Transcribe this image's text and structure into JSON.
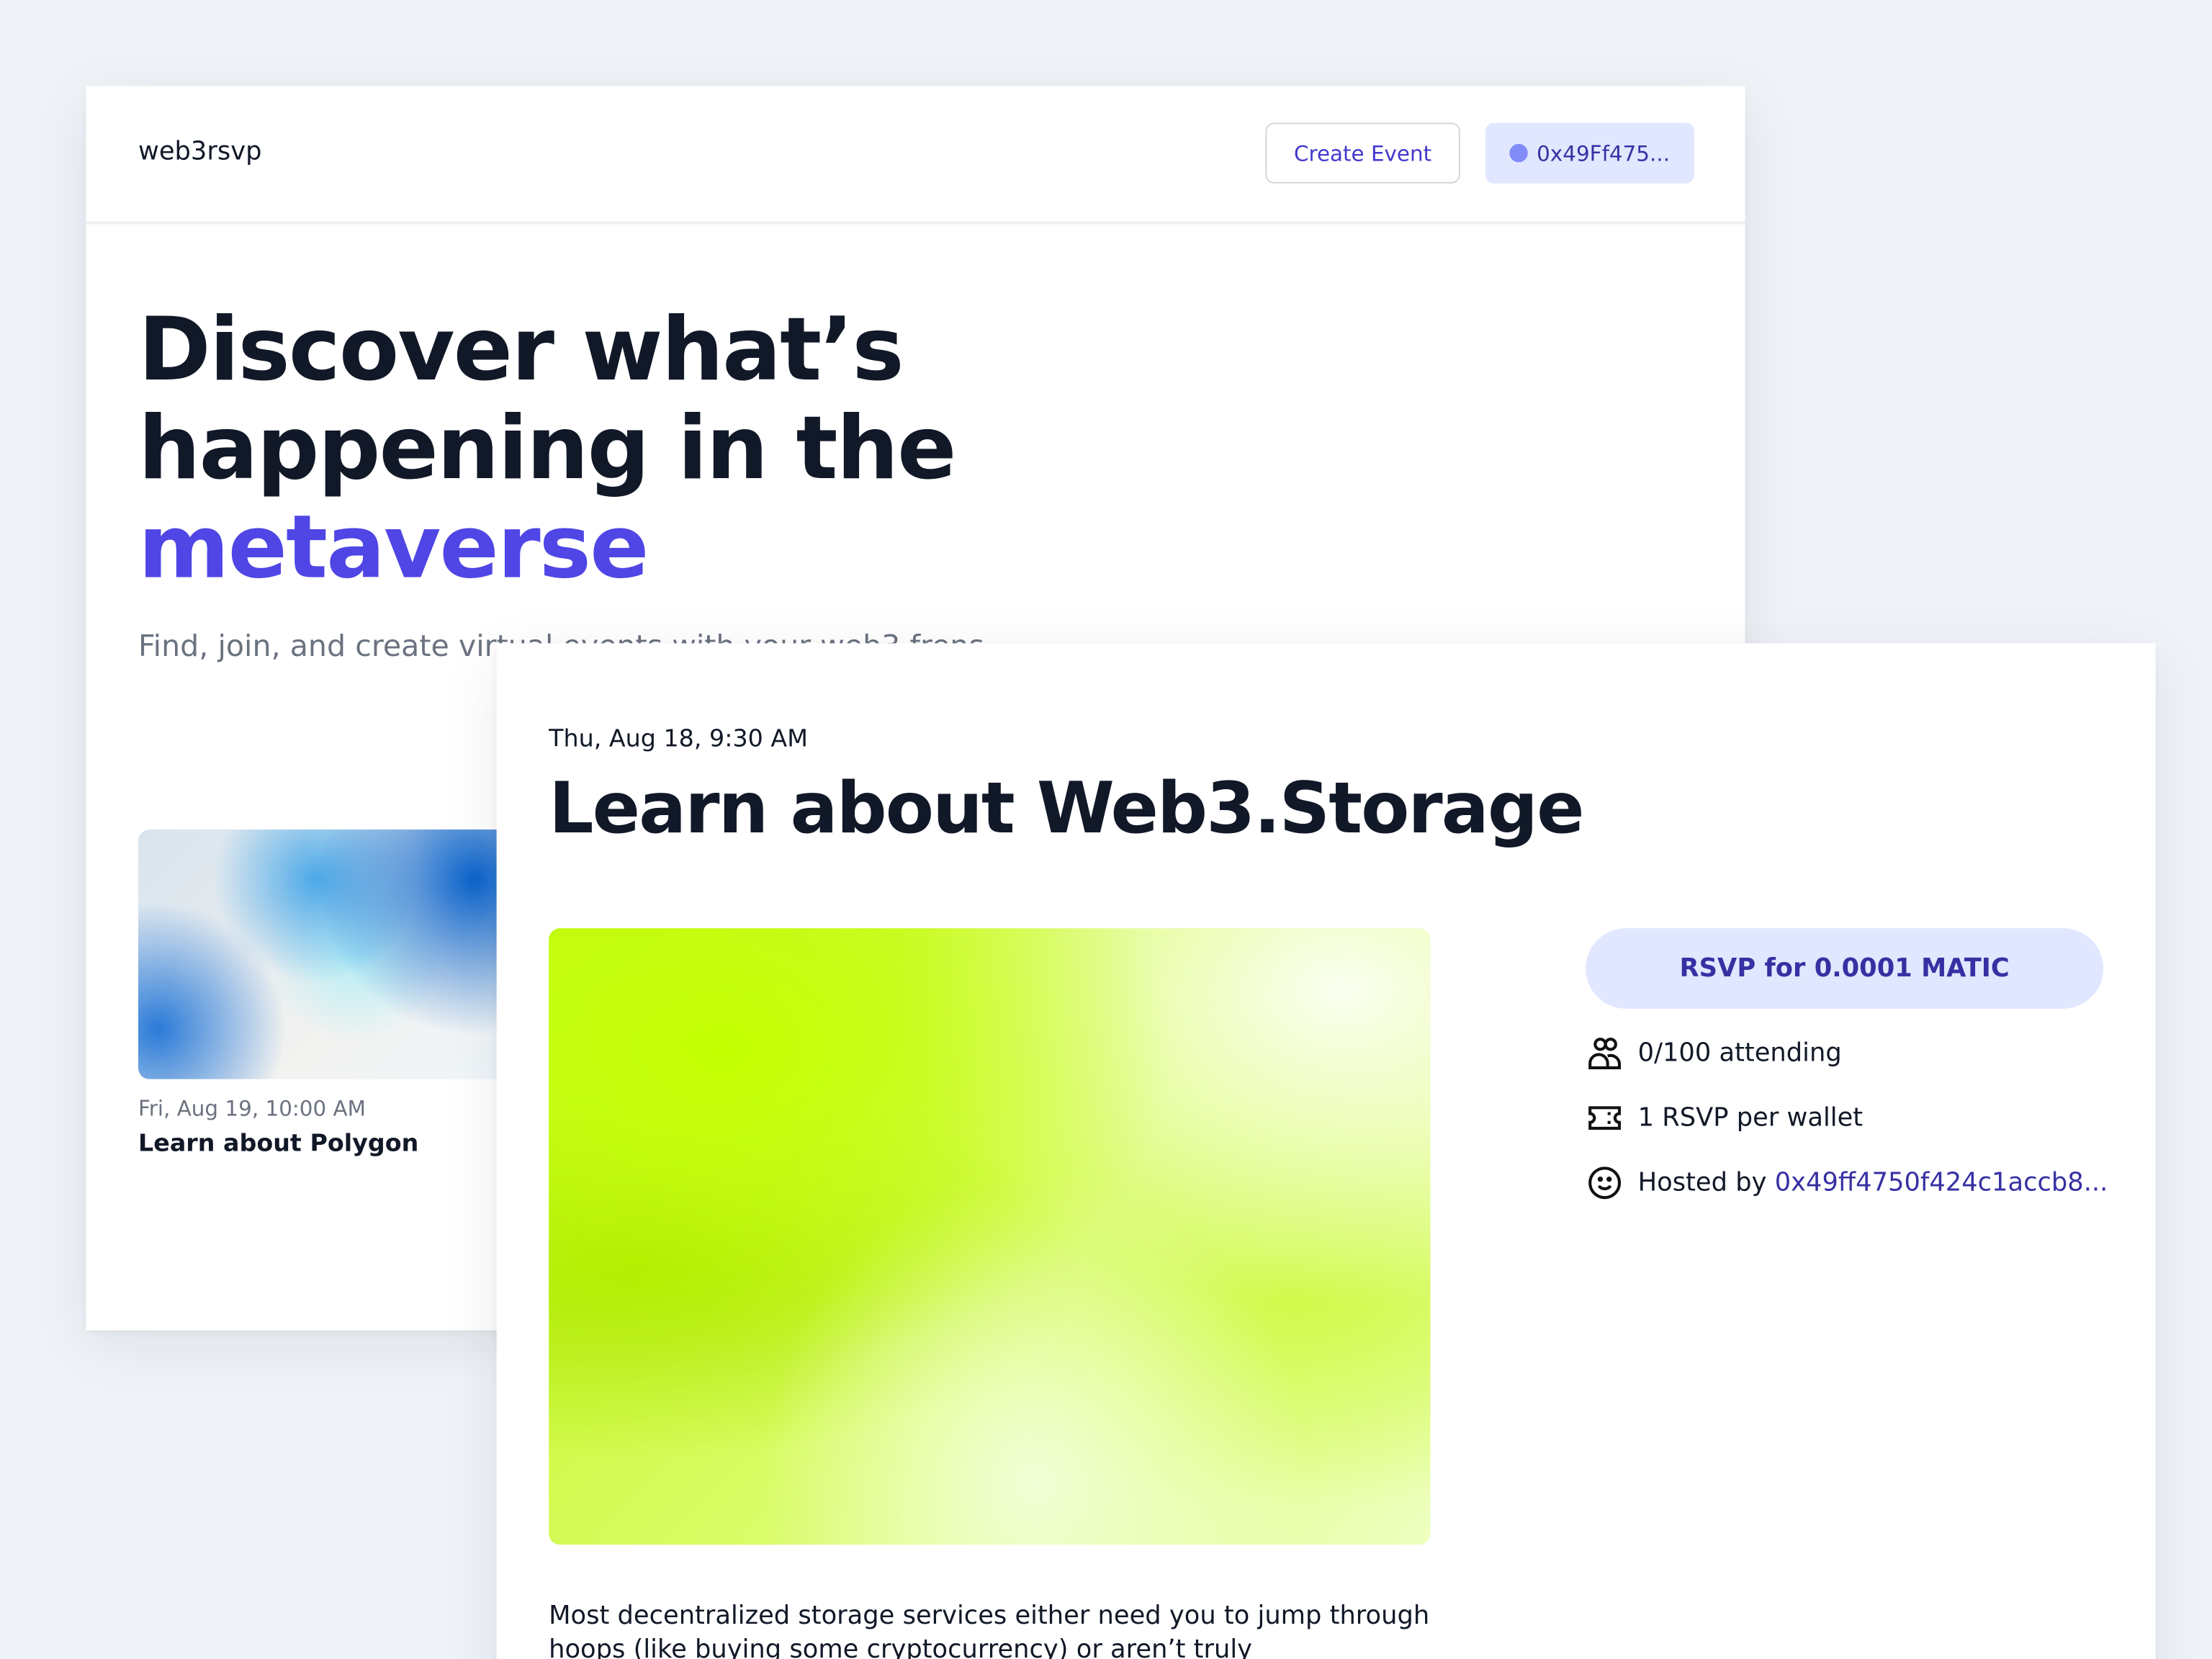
{
  "header": {
    "logo": "web3rsvp",
    "create_event_label": "Create Event",
    "wallet_label": "0x49Ff475..."
  },
  "hero": {
    "line1": "Discover what’s",
    "line2": "happening in the",
    "accent": "metaverse",
    "subtitle": "Find, join, and create virtual events with your web3 frens"
  },
  "event_card": {
    "date": "Fri, Aug 19, 10:00 AM",
    "title": "Learn about Polygon"
  },
  "event_detail": {
    "date": "Thu, Aug 18, 9:30 AM",
    "title": "Learn about Web3.Storage",
    "rsvp_label": "RSVP for 0.0001 MATIC",
    "attending": "0/100 attending",
    "limit": "1 RSVP per wallet",
    "hosted_prefix": "Hosted by ",
    "host": "0x49ff4750f424c1accb8...",
    "description": "Most decentralized storage services either need you to jump through hoops (like buying some cryptocurrency) or aren’t truly"
  },
  "colors": {
    "accent": "#4f46e5",
    "button_bg": "#e0e7ff",
    "button_text": "#3730a3",
    "background": "#eff3f8"
  }
}
